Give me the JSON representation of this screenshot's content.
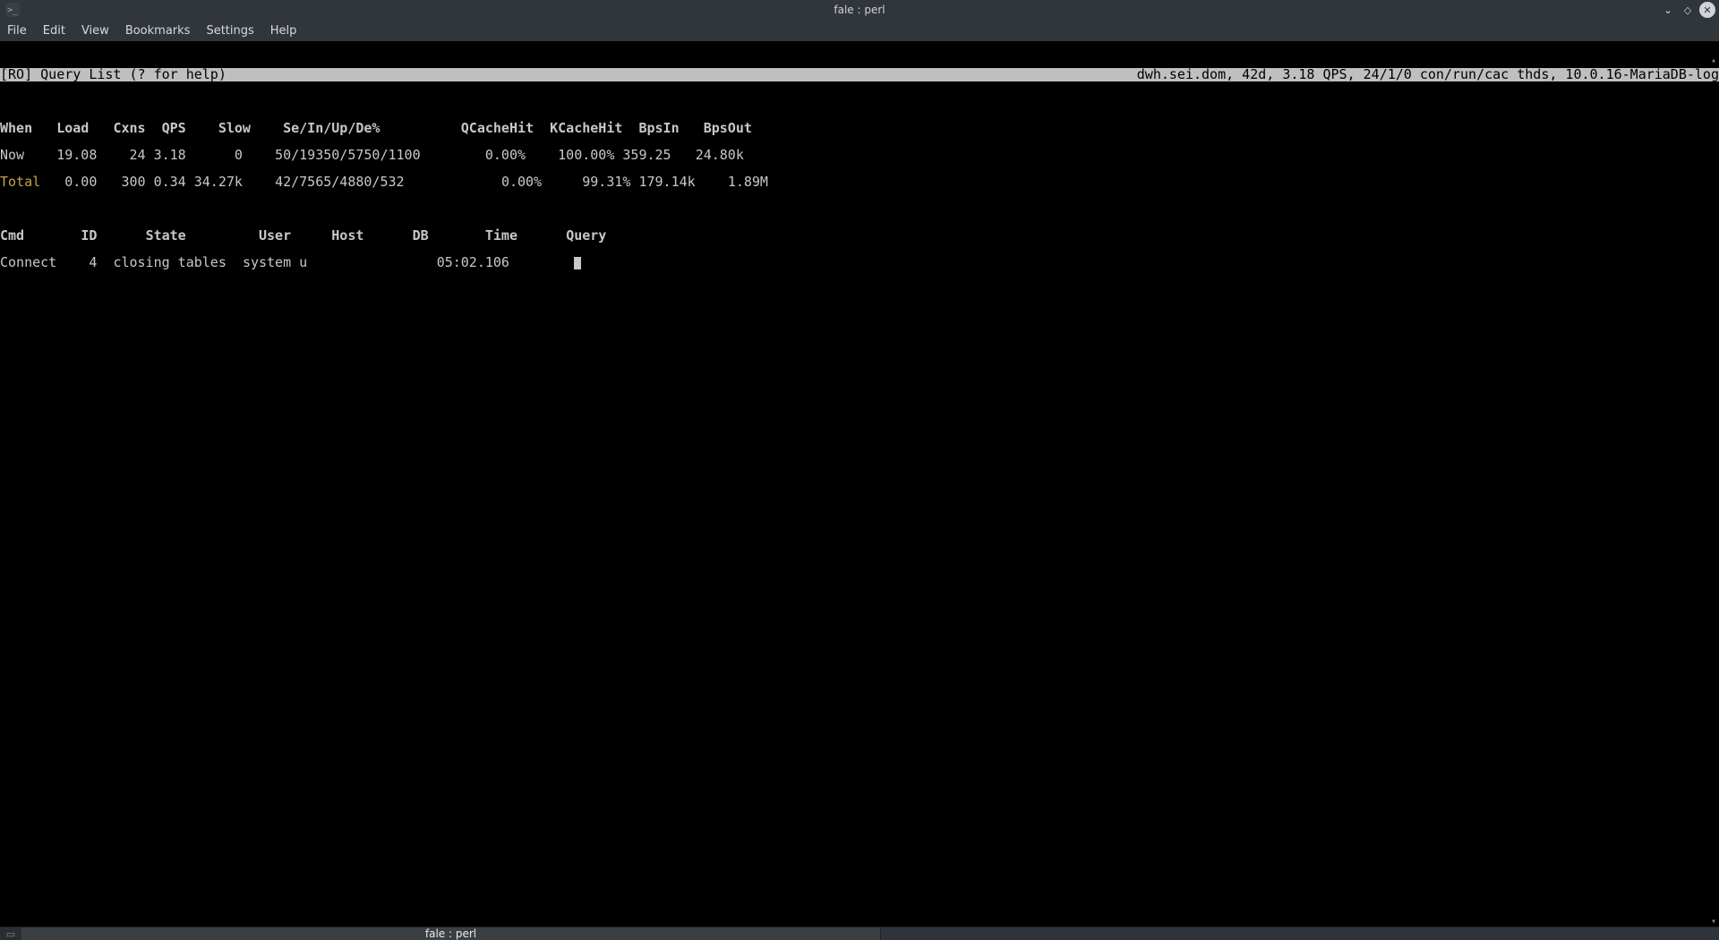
{
  "window": {
    "title": "fale : perl",
    "app_icon_glyph": ">_"
  },
  "menubar": [
    "File",
    "Edit",
    "View",
    "Bookmarks",
    "Settings",
    "Help"
  ],
  "status_left": "[RO] Query List (? for help)",
  "status_right": "dwh.sei.dom, 42d, 3.18 QPS, 24/1/0 con/run/cac thds, 10.0.16-MariaDB-log",
  "stats_headers": [
    "When",
    "Load",
    "Cxns",
    "QPS",
    "Slow",
    "Se/In/Up/De%",
    "QCacheHit",
    "KCacheHit",
    "BpsIn",
    "BpsOut"
  ],
  "stats_rows": [
    {
      "When": "Now",
      "Load": "19.08",
      "Cxns": "24",
      "QPS": "3.18",
      "Slow": "0",
      "SeInUpDe": "50/19350/5750/1100",
      "QCacheHit": "0.00%",
      "KCacheHit": "100.00%",
      "BpsIn": "359.25",
      "BpsOut": "24.80k"
    },
    {
      "When": "Total",
      "Load": "0.00",
      "Cxns": "300",
      "QPS": "0.34",
      "Slow": "34.27k",
      "SeInUpDe": "42/7565/4880/532",
      "QCacheHit": "0.00%",
      "KCacheHit": "99.31%",
      "BpsIn": "179.14k",
      "BpsOut": "1.89M"
    }
  ],
  "proc_headers": [
    "Cmd",
    "ID",
    "State",
    "User",
    "Host",
    "DB",
    "Time",
    "Query"
  ],
  "proc_rows": [
    {
      "Cmd": "Connect",
      "ID": "4",
      "State": "closing tables",
      "User": "system u",
      "Host": "",
      "DB": "",
      "Time": "05:02.106",
      "Query": ""
    }
  ],
  "tab": {
    "label": "fale : perl",
    "newtab_glyph": "▭"
  }
}
